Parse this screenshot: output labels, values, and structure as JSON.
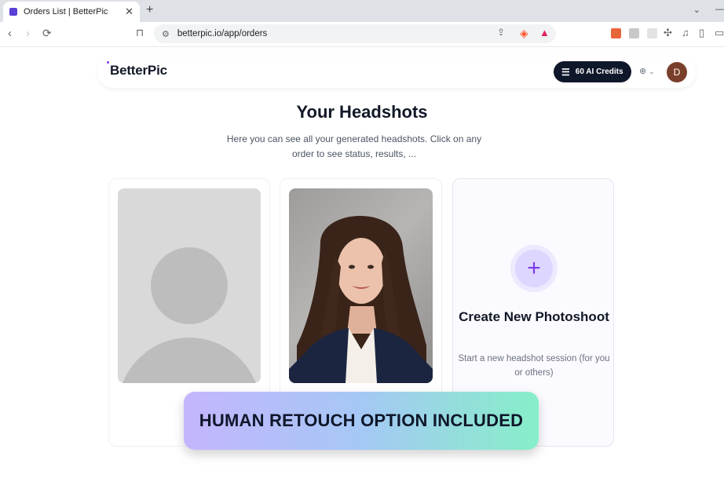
{
  "browser": {
    "tab_title": "Orders List | BetterPic",
    "tab_close": "✕",
    "new_tab": "+",
    "url": "betterpic.io/app/orders"
  },
  "header": {
    "logo_text": "BetterPic",
    "credits_label": "60 AI Credits",
    "avatar_initial": "D"
  },
  "main": {
    "title": "Your Headshots",
    "subtitle": "Here you can see all your generated headshots. Click on any order to see status, results, ...",
    "create_card": {
      "title": "Create New Photoshoot",
      "subtitle": "Start a new headshot session (for you or others)"
    }
  },
  "banner": {
    "text": "HUMAN RETOUCH OPTION INCLUDED"
  },
  "colors": {
    "accent": "#7c3aed",
    "credits_bg": "#0f172a",
    "banner_gradient_start": "#c4b5fd",
    "banner_gradient_end": "#86efc8"
  }
}
